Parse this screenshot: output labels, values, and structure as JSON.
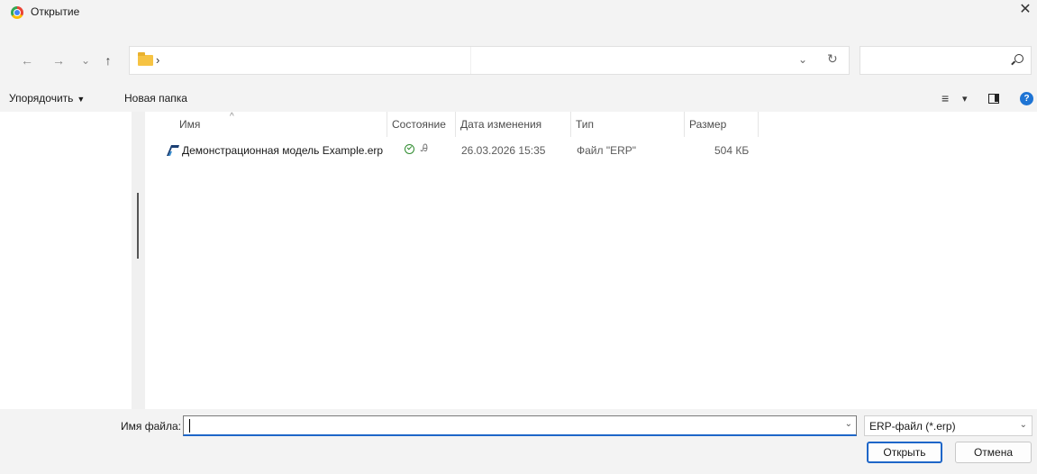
{
  "window": {
    "title": "Открытие",
    "close_glyph": "✕"
  },
  "nav": {
    "back_glyph": "←",
    "forward_glyph": "→",
    "recent_glyph": "⌄",
    "up_glyph": "↑",
    "address_chevron": "›",
    "address_dropdown_glyph": "⌄",
    "refresh_glyph": "↻"
  },
  "toolbar": {
    "organize_label": "Упорядочить",
    "organize_caret": "▼",
    "new_folder_label": "Новая папка",
    "view_glyph": "≡",
    "view_caret": "▾",
    "help_glyph": "?"
  },
  "columns": [
    {
      "label": "Имя"
    },
    {
      "label": "Состояние"
    },
    {
      "label": "Дата изменения"
    },
    {
      "label": "Тип"
    },
    {
      "label": "Размер"
    }
  ],
  "sort_indicator": "^",
  "files": [
    {
      "name": "Демонстрационная модель Example.erp",
      "status_user_glyph": "Ꭿ",
      "modified": "26.03.2026 15:35",
      "type": "Файл \"ERP\"",
      "size": "504 КБ"
    }
  ],
  "bottom": {
    "filename_label": "Имя файла:",
    "filename_value": "",
    "filename_dropdown_glyph": "⌄",
    "filter_value": "ERP-файл (*.erp)",
    "filter_dropdown_glyph": "⌄",
    "open_label": "Открыть",
    "cancel_label": "Отмена"
  },
  "colors": {
    "chrome_bg": "#f3f3f3",
    "accent": "#1e66c8",
    "status_ok": "#2e8b2e",
    "help": "#1e74d4"
  },
  "icons": {
    "app": "chrome-icon",
    "folder": "folder-icon",
    "search": "search-icon",
    "pane": "preview-pane-icon",
    "file": "erp-file-icon"
  }
}
